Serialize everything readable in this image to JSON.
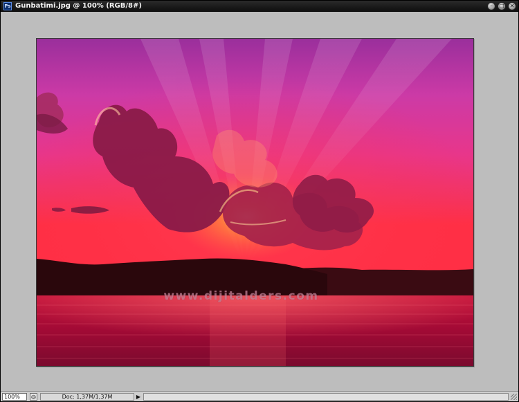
{
  "window": {
    "title": "Gunbatimi.jpg @ 100% (RGB/8#)",
    "app_icon": "photoshop-document-icon",
    "controls": [
      {
        "name": "minimize-icon",
        "glyph": "–"
      },
      {
        "name": "maximize-icon",
        "glyph": "□"
      },
      {
        "name": "close-icon",
        "glyph": "✕"
      }
    ]
  },
  "image": {
    "watermark": "www.dijitalders.com"
  },
  "status": {
    "zoom": "100%",
    "doc_info": "Doc: 1,37M/1,37M",
    "menu_arrow": "▶",
    "info_icon": "◎"
  }
}
